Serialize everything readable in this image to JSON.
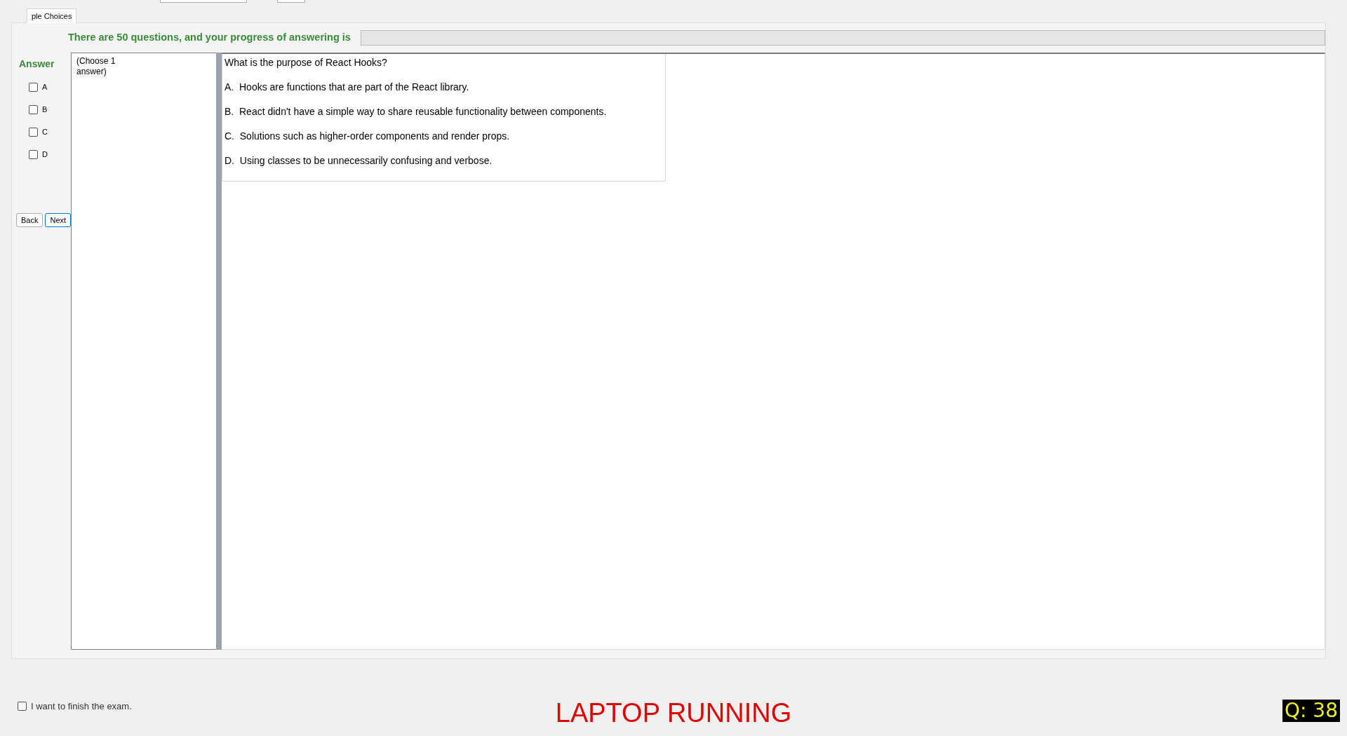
{
  "tab": {
    "label": "ple Choices",
    "selected": true
  },
  "progress": {
    "text": "There are 50 questions, and your progress of answering is",
    "level": 0
  },
  "answer": {
    "title": "Answer",
    "options": [
      {
        "label": "A",
        "checked": false
      },
      {
        "label": "B",
        "checked": false
      },
      {
        "label": "C",
        "checked": false
      },
      {
        "label": "D",
        "checked": false
      }
    ]
  },
  "buttons": [
    {
      "label": "Back",
      "focused": false
    },
    {
      "label": "Next",
      "focused": true
    }
  ],
  "instruction": "(Choose 1 answer)",
  "question": {
    "text": "What is the purpose of React Hooks?",
    "options": [
      "A.  Hooks are functions that are part of the React library.",
      "B.  React didn't have a simple way to share reusable functionality between components.",
      "C.  Solutions such as higher-order components and render props.",
      "D.  Using classes to be unnecessarily confusing and verbose."
    ]
  },
  "finish": {
    "label": "I want to finish the exam.",
    "checked": false
  },
  "status": "LAPTOP RUNNING",
  "question_number": "Q: 38"
}
